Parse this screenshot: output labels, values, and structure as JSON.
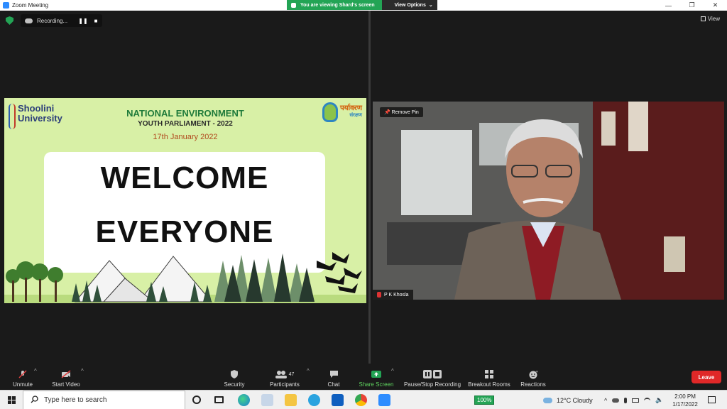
{
  "window": {
    "title": "Zoom Meeting",
    "minimize": "—",
    "restore": "❐",
    "close": "✕"
  },
  "share_banner": {
    "viewing": "You are viewing Shard's screen",
    "options": "View Options",
    "chevron": "⌄"
  },
  "recording": {
    "label": "Recording...",
    "pause": "❚❚",
    "stop": "■"
  },
  "view_button": "View",
  "slide": {
    "university_line1": "Shoolini",
    "university_line2": "University",
    "title": "NATIONAL ENVIRONMENT",
    "subtitle": "YOUTH PARLIAMENT - 2022",
    "date": "17th January 2022",
    "welcome_line1": "WELCOME",
    "welcome_line2": "EVERYONE",
    "logo_text1": "पर्यावरण",
    "logo_text2": "संरक्षण"
  },
  "video": {
    "pin_label": "Remove Pin",
    "participant_name": "P K Khosla"
  },
  "toolbar": {
    "unmute": "Unmute",
    "start_video": "Start Video",
    "security": "Security",
    "participants": "Participants",
    "participants_count": "47",
    "chat": "Chat",
    "share_screen": "Share Screen",
    "pause_stop_recording": "Pause/Stop Recording",
    "breakout_rooms": "Breakout Rooms",
    "reactions": "Reactions",
    "leave": "Leave",
    "caret": "^"
  },
  "taskbar": {
    "search_placeholder": "Type here to search",
    "battery": "100%",
    "weather": "12°C  Cloudy",
    "time": "2:00 PM",
    "date": "1/17/2022"
  },
  "colors": {
    "zoom_blue": "#2d8cff",
    "share_green": "#23a455",
    "leave_red": "#e02828",
    "slide_bg": "#d8f0a6"
  }
}
